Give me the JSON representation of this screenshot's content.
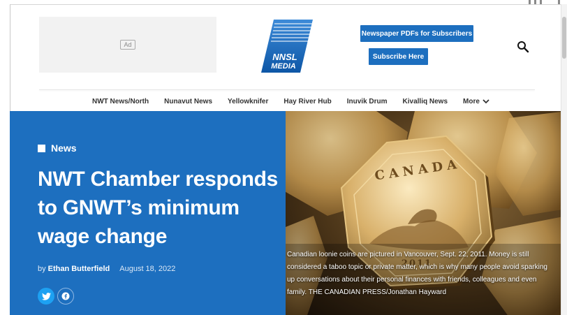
{
  "ad": {
    "label": "Ad"
  },
  "logo": {
    "line1": "NNSL",
    "line2": "MEDIA"
  },
  "header": {
    "pdf_button": "Newspaper PDFs for Subscribers",
    "subscribe_button": "Subscribe Here",
    "search_icon": "search-icon"
  },
  "nav": {
    "items": [
      "NWT News/North",
      "Nunavut News",
      "Yellowknifer",
      "Hay River Hub",
      "Inuvik Drum",
      "Kivalliq News"
    ],
    "more": "More"
  },
  "article": {
    "category": "News",
    "headline_lines": [
      "NWT Chamber responds",
      "to GNWT’s minimum",
      "wage change"
    ],
    "by": "by",
    "author": "Ethan Butterfield",
    "date": "August 18, 2022",
    "share_icons": [
      "twitter-icon",
      "facebook-icon"
    ]
  },
  "photo": {
    "coin_text_1": "CANADA",
    "coin_text_2": "2011",
    "caption": "Canadian loonie coins are pictured in Vancouver, Sept. 22, 2011. Money is still considered a taboo topic or private matter, which is why many people avoid sparking up conversations about their personal finances with friends, colleagues and even family. THE CANADIAN PRESS/Jonathan Hayward"
  },
  "colors": {
    "brand_blue": "#1d6fbf",
    "twitter": "#1da1f2"
  }
}
